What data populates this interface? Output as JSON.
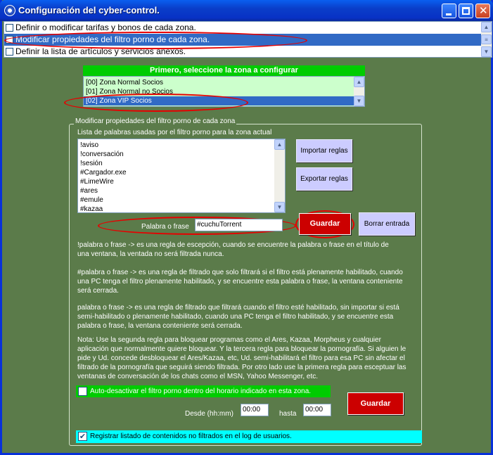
{
  "window": {
    "title": "Configuración del cyber-control."
  },
  "options": [
    {
      "label": "Definir o modificar tarifas y bonos de cada zona.",
      "checked": false,
      "selected": false
    },
    {
      "label": "Modificar propiedades del filtro porno de cada zona.",
      "checked": false,
      "selected": true
    },
    {
      "label": "Definir la lista de artículos y servicios anexos.",
      "checked": false,
      "selected": false
    }
  ],
  "zones": {
    "header": "Primero, seleccione la zona a configurar",
    "items": [
      "[00] Zona Normal Socios",
      "[01] Zona Normal no Socios",
      "[02] Zona VIP Socios"
    ],
    "selected_index": 2
  },
  "filter": {
    "group_title": "Modificar propiedades del filtro porno de cada zona",
    "list_label": "Lista de palabras usadas por el filtro porno para la zona actual",
    "words": [
      "!aviso",
      "!conversación",
      "!sesión",
      "#Cargador.exe",
      "#LimeWire",
      "#ares",
      "#emule",
      "#kazaa"
    ],
    "import_label": "Importar reglas",
    "export_label": "Exportar reglas",
    "phrase_label": "Palabra o frase",
    "phrase_value": "#cuchuTorrent",
    "save_label": "Guardar",
    "delete_label": "Borrar entrada"
  },
  "help": {
    "p1a": "!palabra o frase    ->   es una regla de escepción, cuando se encuentre la palabra o frase en el título de",
    "p1b": "una ventana, la ventada no será filtrada nunca.",
    "p2a": "#palabra o frase    ->   es una regla de filtrado que solo filtrará si el filtro está plenamente habilitado, cuando",
    "p2b": "una PC tenga el filtro plenamente habilitado, y se encuentre esta palabra o frase, la ventana conteniente",
    "p2c": "será cerrada.",
    "p3a": "palabra o frase      ->   es una regla de filtrado que filtrará cuando el filtro esté habilitado, sin importar si está",
    "p3b": "semi-habilitado o plenamente habilitado, cuando una PC tenga el filtro habilitado, y se encuentre esta",
    "p3c": "palabra o frase, la ventana conteniente será cerrada.",
    "p4a": "Nota: Use la segunda regla para bloquear programas como el Ares, Kazaa, Morpheus y cualquier",
    "p4b": "aplicación que normalmente quiere bloquear. Y la tercera regla para bloquear la pornografía. Si alguien le",
    "p4c": "pide y Ud. concede desbloquear el Ares/Kazaa, etc, Ud. semi-habilitará el filtro para esa PC sin afectar el",
    "p4d": "filtrado de la pornografía que seguirá siendo filtrada. Por otro lado use la primera regla para esceptuar las",
    "p4e": "ventanas de conversación de los chats como el MSN, Yahoo Messenger, etc."
  },
  "schedule": {
    "auto_label": "Auto-desactivar el filtro porno dentro del horario indicado en esta zona.",
    "auto_checked": false,
    "from_label": "Desde (hh:mm)",
    "from_value": "00:00",
    "to_label": "hasta",
    "to_value": "00:00",
    "save_label": "Guardar"
  },
  "log": {
    "label": "Registrar listado de contenidos no filtrados en el log de usuarios.",
    "checked": true
  },
  "colors": {
    "accent_green": "#00cc00",
    "save_red": "#cc0000",
    "annotation_red": "#e60000",
    "selection_blue": "#316ac5"
  }
}
